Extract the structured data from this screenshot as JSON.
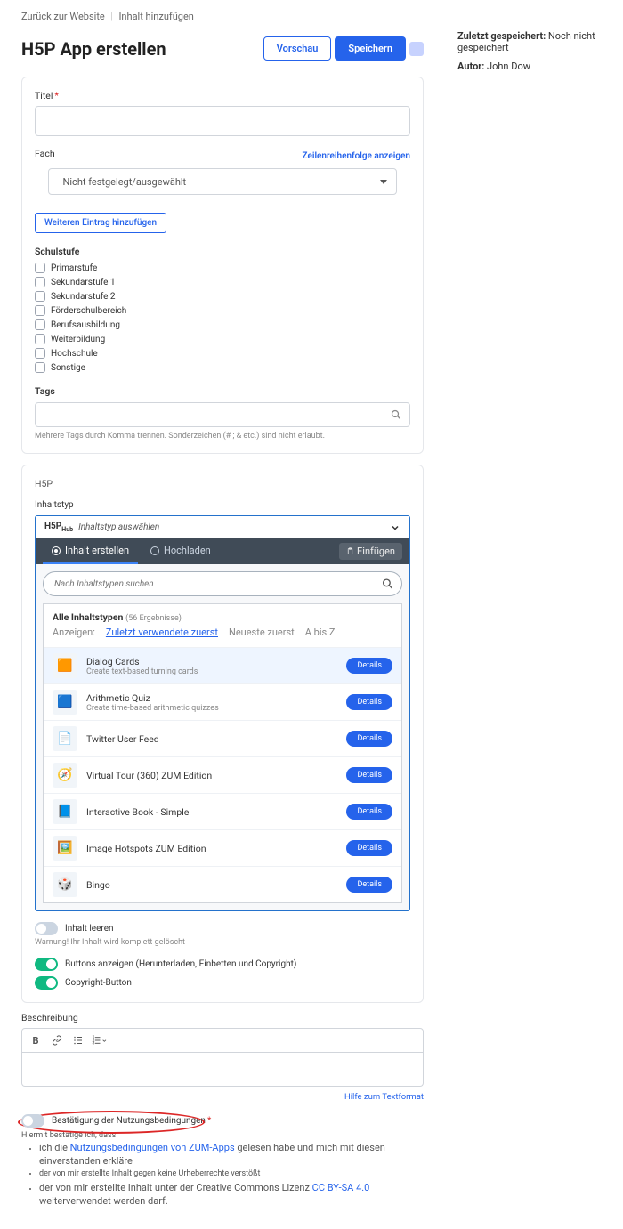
{
  "breadcrumbs": {
    "back": "Zurück zur Website",
    "add": "Inhalt hinzufügen"
  },
  "header": {
    "title": "H5P App erstellen",
    "preview": "Vorschau",
    "save": "Speichern"
  },
  "form": {
    "title_label": "Titel",
    "subject_label": "Fach",
    "rows_link": "Zeilenreihenfolge anzeigen",
    "subject_placeholder": "- Nicht festgelegt/ausgewählt -",
    "add_entry": "Weiteren Eintrag hinzufügen",
    "schulstufe_label": "Schulstufe",
    "schulstufe_items": [
      "Primarstufe",
      "Sekundarstufe 1",
      "Sekundarstufe 2",
      "Förderschulbereich",
      "Berufsausbildung",
      "Weiterbildung",
      "Hochschule",
      "Sonstige"
    ],
    "tags_label": "Tags",
    "tags_help": "Mehrere Tags durch Komma trennen. Sonderzeichen (# ; & etc.) sind nicht erlaubt."
  },
  "h5p": {
    "section": "H5P",
    "inhaltstyp": "Inhaltstyp",
    "hub_select": "Inhaltstyp auswählen",
    "tab_create": "Inhalt erstellen",
    "tab_upload": "Hochladen",
    "paste": "Einfügen",
    "search_placeholder": "Nach Inhaltstypen suchen",
    "all_types": "Alle Inhaltstypen",
    "count": "(56 Ergebnisse)",
    "sort_label": "Anzeigen:",
    "sort_recent": "Zuletzt verwendete zuerst",
    "sort_newest": "Neueste zuerst",
    "sort_az": "A bis Z",
    "details": "Details",
    "items": [
      {
        "name": "Dialog Cards",
        "sub": "Create text-based turning cards",
        "icon": "🟧"
      },
      {
        "name": "Arithmetic Quiz",
        "sub": "Create time-based arithmetic quizzes",
        "icon": "🟦"
      },
      {
        "name": "Twitter User Feed",
        "sub": "",
        "icon": "📄"
      },
      {
        "name": "Virtual Tour (360) ZUM Edition",
        "sub": "",
        "icon": "🧭"
      },
      {
        "name": "Interactive Book - Simple",
        "sub": "",
        "icon": "📘"
      },
      {
        "name": "Image Hotspots ZUM Edition",
        "sub": "",
        "icon": "🖼️"
      },
      {
        "name": "Bingo",
        "sub": "",
        "icon": "🎲"
      }
    ],
    "clear_label": "Inhalt leeren",
    "clear_warn": "Warnung! Ihr Inhalt wird komplett gelöscht",
    "buttons_label": "Buttons anzeigen (Herunterladen, Einbetten und Copyright)",
    "copyright_label": "Copyright-Button"
  },
  "desc": {
    "label": "Beschreibung",
    "help": "Hilfe zum Textformat"
  },
  "terms": {
    "label": "Bestätigung der Nutzungsbedingungen",
    "intro": "Hiermit bestätige ich, dass",
    "b1a": "ich die ",
    "b1link": "Nutzungsbedingungen von ZUM-Apps",
    "b1b": " gelesen habe und mich mit diesen einverstanden erkläre",
    "b2": "der von mir erstellte Inhalt gegen keine Urheberrechte verstößt",
    "b3a": "der von mir erstellte Inhalt unter der Creative Commons Lizenz ",
    "b3link": "CC BY-SA 4.0",
    "b3b": " weiterverwendet werden darf."
  },
  "side": {
    "saved_label": "Zuletzt gespeichert:",
    "saved_val": "Noch nicht gespeichert",
    "author_label": "Autor:",
    "author_val": "John Dow"
  }
}
